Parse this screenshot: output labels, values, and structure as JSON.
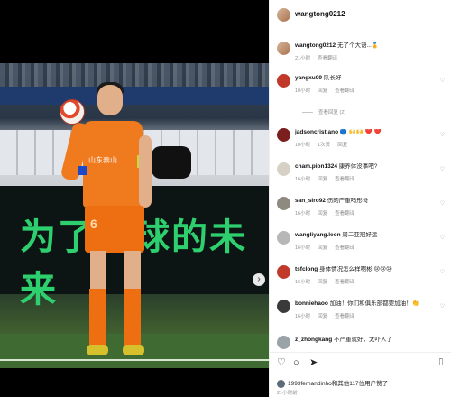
{
  "colors": {
    "banner_text": "#2ecf6e",
    "jersey": "#f07a1e",
    "link_gray": "#8e8e8e",
    "heart_red": "#e0245e"
  },
  "post": {
    "author": "wangtong0212",
    "image": {
      "banner_text": "为了足球的未来",
      "jersey_text": "山东泰山",
      "shorts_number": "6",
      "next_icon": "chevron-right-icon"
    }
  },
  "comments": [
    {
      "user": "wangtong0212",
      "text": "无了个大语...🏅",
      "time": "21小时",
      "actions": [
        "查看翻译"
      ]
    },
    {
      "user": "yangxu09",
      "text": "队长好",
      "time": "10小时",
      "actions": [
        "回复",
        "查看翻译"
      ],
      "replies": "查看回复 (2)"
    },
    {
      "user": "jadsoncristiano",
      "text": "🔵 🙌🙌 ❤️ ❤️",
      "time": "10小时",
      "actions": [
        "1次赞",
        "回复"
      ]
    },
    {
      "user": "cham.pion1324",
      "text": "康养体没事吧?",
      "time": "16小时",
      "actions": [
        "回复",
        "查看翻译"
      ]
    },
    {
      "user": "san_siro92",
      "text": "伤的严重吗彤哥",
      "time": "16小时",
      "actions": [
        "回复",
        "查看翻译"
      ]
    },
    {
      "user": "wangliyang.leon",
      "text": "周二亚冠好运",
      "time": "16小时",
      "actions": [
        "回复",
        "查看翻译"
      ]
    },
    {
      "user": "tsfclong",
      "text": "身体情况怎么样啊彬 😢😢😢",
      "time": "16小时",
      "actions": [
        "回复",
        "查看翻译"
      ]
    },
    {
      "user": "bonniehaoo",
      "text": "加油！你们和俱乐部都要加油！👏",
      "time": "16小时",
      "actions": [
        "回复",
        "查看翻译"
      ]
    },
    {
      "user": "z_zhongkang",
      "text": "不严重就好，太吓人了",
      "time": "",
      "actions": []
    }
  ],
  "actions": {
    "like_icon": "heart-icon",
    "comment_icon": "comment-icon",
    "share_icon": "share-icon",
    "save_icon": "bookmark-icon"
  },
  "likes_text": "1993fernandinho和其他117位用户赞了",
  "posted_time": "21小时前"
}
